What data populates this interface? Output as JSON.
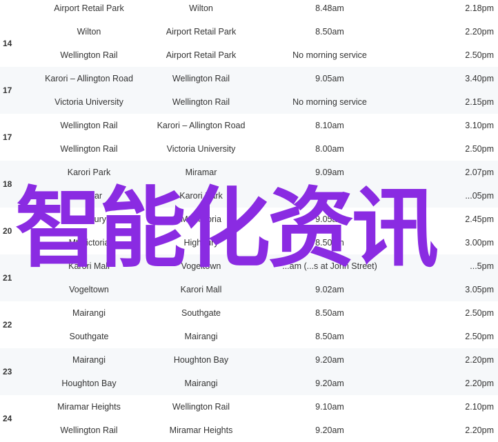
{
  "groups": [
    {
      "route": "",
      "shaded": false,
      "rows": [
        {
          "from": "Airport Retail Park",
          "to": "Wilton",
          "morning": "8.48am",
          "afternoon": "2.18pm"
        }
      ]
    },
    {
      "route": "14",
      "shaded": false,
      "rows": [
        {
          "from": "Wilton",
          "to": "Airport Retail Park",
          "morning": "8.50am",
          "afternoon": "2.20pm"
        },
        {
          "from": "Wellington Rail",
          "to": "Airport Retail Park",
          "morning": "No morning service",
          "afternoon": "2.50pm"
        }
      ]
    },
    {
      "route": "17",
      "shaded": true,
      "rows": [
        {
          "from": "Karori – Allington Road",
          "to": "Wellington Rail",
          "morning": "9.05am",
          "afternoon": "3.40pm"
        },
        {
          "from": "Victoria University",
          "to": "Wellington Rail",
          "morning": "No morning service",
          "afternoon": "2.15pm"
        }
      ]
    },
    {
      "route": "17",
      "shaded": false,
      "rows": [
        {
          "from": "Wellington Rail",
          "to": "Karori – Allington Road",
          "morning": "8.10am",
          "afternoon": "3.10pm"
        },
        {
          "from": "Wellington Rail",
          "to": "Victoria University",
          "morning": "8.00am",
          "afternoon": "2.50pm"
        }
      ]
    },
    {
      "route": "18",
      "shaded": true,
      "rows": [
        {
          "from": "Karori Park",
          "to": "Miramar",
          "morning": "9.09am",
          "afternoon": "2.07pm"
        },
        {
          "from": "Mir...ar",
          "to": "Karori Park",
          "morning": "...",
          "afternoon": "...05pm"
        }
      ]
    },
    {
      "route": "20",
      "shaded": false,
      "rows": [
        {
          "from": "Highbury",
          "to": "Mt Victoria",
          "morning": "9.05am",
          "afternoon": "2.45pm"
        },
        {
          "from": "Mt Victoria",
          "to": "Highbury",
          "morning": "8.50am",
          "afternoon": "3.00pm"
        }
      ]
    },
    {
      "route": "21",
      "shaded": true,
      "rows": [
        {
          "from": "Karori Mall",
          "to": "Vogeltown",
          "morning": "...am (...s at John Street)",
          "afternoon": "...5pm"
        },
        {
          "from": "Vogeltown",
          "to": "Karori Mall",
          "morning": "9.02am",
          "afternoon": "3.05pm"
        }
      ]
    },
    {
      "route": "22",
      "shaded": false,
      "rows": [
        {
          "from": "Mairangi",
          "to": "Southgate",
          "morning": "8.50am",
          "afternoon": "2.50pm"
        },
        {
          "from": "Southgate",
          "to": "Mairangi",
          "morning": "8.50am",
          "afternoon": "2.50pm"
        }
      ]
    },
    {
      "route": "23",
      "shaded": true,
      "rows": [
        {
          "from": "Mairangi",
          "to": "Houghton Bay",
          "morning": "9.20am",
          "afternoon": "2.20pm"
        },
        {
          "from": "Houghton Bay",
          "to": "Mairangi",
          "morning": "9.20am",
          "afternoon": "2.20pm"
        }
      ]
    },
    {
      "route": "24",
      "shaded": false,
      "rows": [
        {
          "from": "Miramar Heights",
          "to": "Wellington Rail",
          "morning": "9.10am",
          "afternoon": "2.10pm"
        },
        {
          "from": "Wellington Rail",
          "to": "Miramar Heights",
          "morning": "9.20am",
          "afternoon": "2.20pm"
        }
      ]
    }
  ],
  "watermark": "智能化资讯"
}
